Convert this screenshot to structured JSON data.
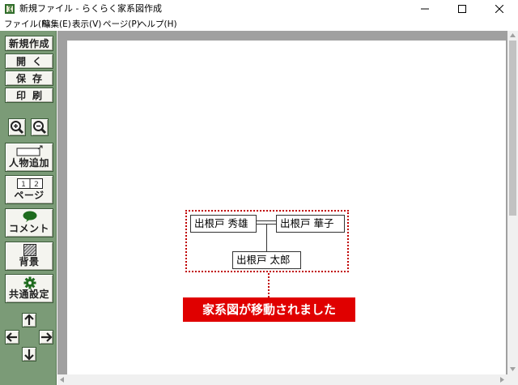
{
  "window": {
    "title": "新規ファイル - らくらく家系図作成"
  },
  "menu": [
    {
      "label": "ファイル(F)"
    },
    {
      "label": "編集(E)"
    },
    {
      "label": "表示(V)"
    },
    {
      "label": "ページ(P)"
    },
    {
      "label": "ヘルプ(H)"
    }
  ],
  "toolbar": {
    "new_label": "新規作成",
    "open_label": "開く",
    "save_label": "保存",
    "print_label": "印刷",
    "zoom_in_icon": "zoom-in-icon",
    "zoom_out_icon": "zoom-out-icon",
    "add_person_label": "人物追加",
    "page_label": "ページ",
    "page_numbers": [
      "1",
      "2"
    ],
    "comment_label": "コメント",
    "background_label": "背景",
    "common_settings_label": "共通設定"
  },
  "tree": {
    "persons": {
      "hideo": "出根戸 秀雄",
      "hanako": "出根戸 華子",
      "taro": "出根戸 太郎"
    },
    "frame_color": "#c00000"
  },
  "notification": {
    "text": "家系図が移動されました",
    "background": "#e00000"
  },
  "colors": {
    "toolbar_bg": "#7b9b77",
    "canvas_bg": "#a0a0a0"
  }
}
